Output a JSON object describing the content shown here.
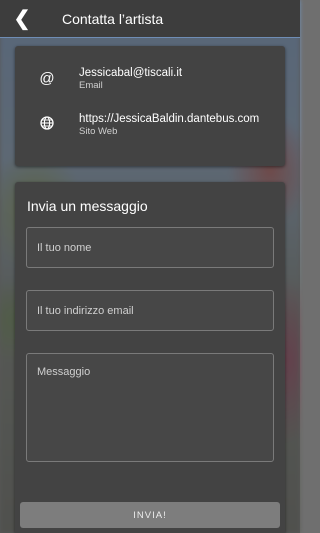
{
  "app_bar": {
    "back_icon": "back-arrow-icon",
    "title": "Contatta l’artista"
  },
  "contact": {
    "email": {
      "icon": "at-icon",
      "value": "Jessicabal@tiscali.it",
      "label": "Email"
    },
    "website": {
      "icon": "globe-icon",
      "value": "https://JessicaBaldin.dantebus.com",
      "label": "Sito Web"
    }
  },
  "message_form": {
    "title": "Invia un messaggio",
    "name_placeholder": "Il tuo nome",
    "email_placeholder": "Il tuo indirizzo email",
    "message_placeholder": "Messaggio",
    "send_label": "INVIA!"
  },
  "colors": {
    "app_bar": "#3d3d3d",
    "card": "#434343",
    "button": "#7d7d7d",
    "accent_line": "#6f8db5"
  }
}
